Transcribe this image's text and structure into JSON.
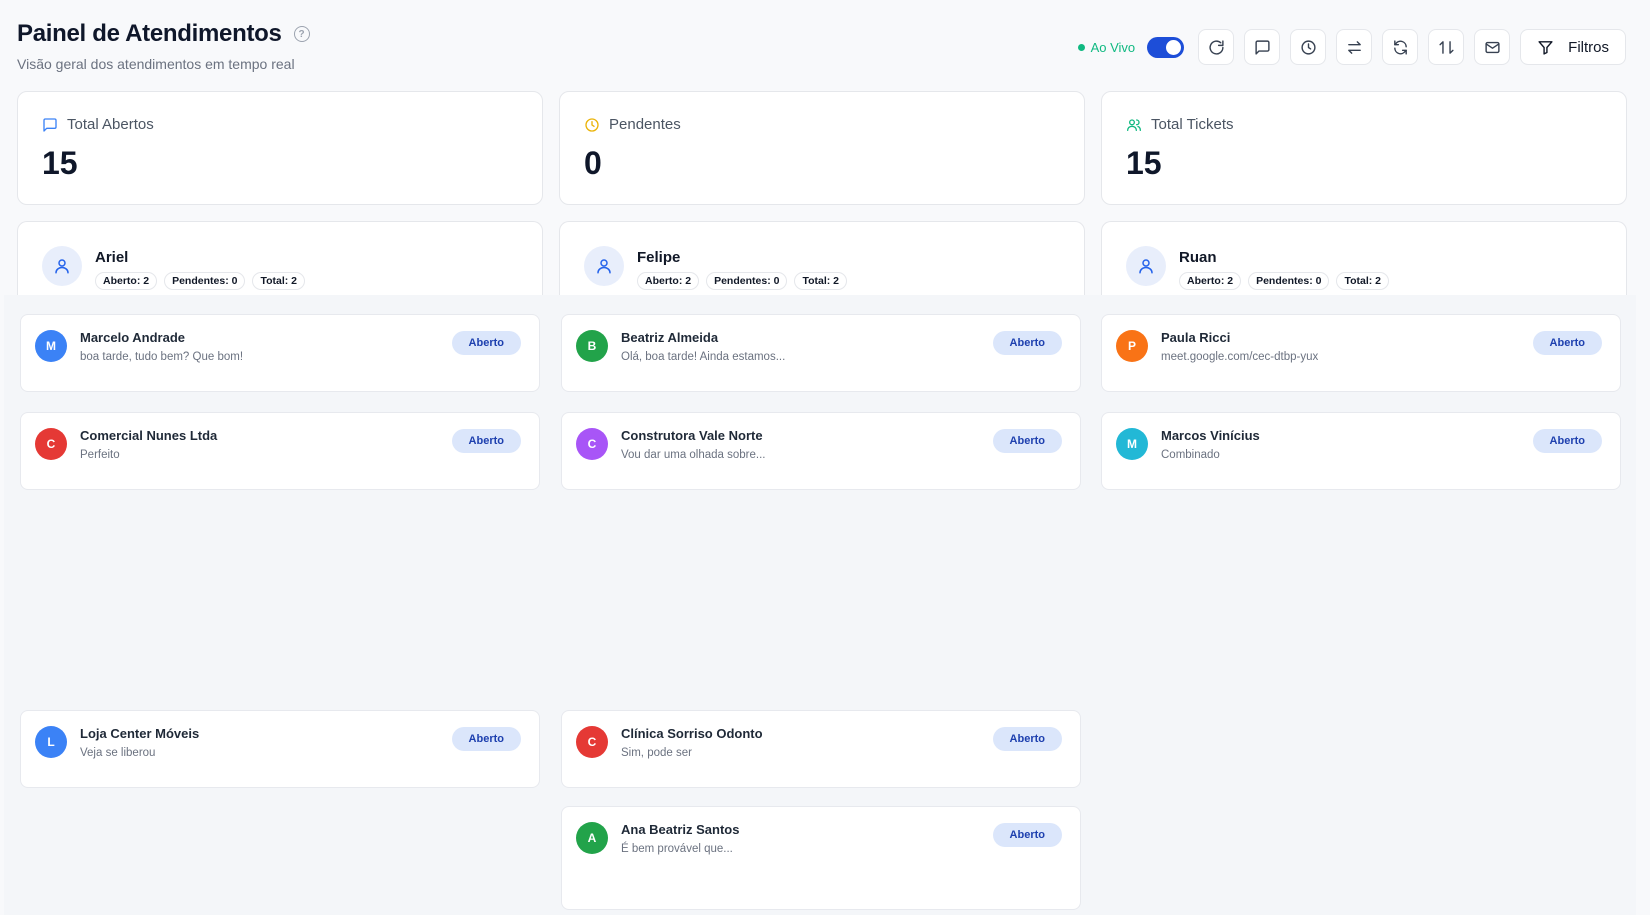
{
  "header": {
    "title": "Painel de Atendimentos",
    "subtitle": "Visão geral dos atendimentos em tempo real",
    "help_icon": "?"
  },
  "toolbar": {
    "live_label": "Ao Vivo",
    "live_enabled": true,
    "filter_label": "Filtros",
    "icons": [
      "refresh-icon",
      "message-icon",
      "clock-icon",
      "transfer-icon",
      "sync-icon",
      "sort-icon",
      "mail-icon",
      "filter-icon"
    ]
  },
  "stats": [
    {
      "label": "Total Abertos",
      "value": "15",
      "icon": "message-icon",
      "color": "#3b82f6"
    },
    {
      "label": "Pendentes",
      "value": "0",
      "icon": "clock-icon",
      "color": "#eab308"
    },
    {
      "label": "Total Tickets",
      "value": "15",
      "icon": "users-icon",
      "color": "#10b981"
    }
  ],
  "agents": [
    {
      "name": "Ariel",
      "aberto": "Aberto: 2",
      "pendentes": "Pendentes: 0",
      "total": "Total: 2"
    },
    {
      "name": "Felipe",
      "aberto": "Aberto: 2",
      "pendentes": "Pendentes: 0",
      "total": "Total: 2"
    },
    {
      "name": "Ruan",
      "aberto": "Aberto: 2",
      "pendentes": "Pendentes: 0",
      "total": "Total: 2"
    }
  ],
  "tickets": [
    {
      "initial": "M",
      "name": "Marcelo Andrade",
      "message": "boa tarde, tudo bem? Que bom!",
      "status": "Aberto",
      "color": "#3b82f6"
    },
    {
      "initial": "B",
      "name": "Beatriz Almeida",
      "message": "Olá, boa tarde! Ainda estamos...",
      "status": "Aberto",
      "color": "#22a34a"
    },
    {
      "initial": "P",
      "name": "Paula Ricci",
      "message": "meet.google.com/cec-dtbp-yux",
      "status": "Aberto",
      "color": "#f97316"
    },
    {
      "initial": "C",
      "name": "Comercial Nunes Ltda",
      "message": "Perfeito",
      "status": "Aberto",
      "color": "#e53935"
    },
    {
      "initial": "C",
      "name": "Construtora Vale Norte",
      "message": "Vou dar uma olhada sobre...",
      "status": "Aberto",
      "color": "#a855f7"
    },
    {
      "initial": "M",
      "name": "Marcos Vinícius",
      "message": "Combinado",
      "status": "Aberto",
      "color": "#22b8d6"
    },
    {
      "initial": "L",
      "name": "Loja Center Móveis",
      "message": "Veja se liberou",
      "status": "Aberto",
      "color": "#3b82f6"
    },
    {
      "initial": "C",
      "name": "Clínica Sorriso Odonto",
      "message": "Sim, pode ser",
      "status": "Aberto",
      "color": "#e53935"
    },
    {
      "initial": "A",
      "name": "Ana Beatriz Santos",
      "message": "É bem provável que...",
      "status": "Aberto",
      "color": "#22a34a"
    }
  ]
}
